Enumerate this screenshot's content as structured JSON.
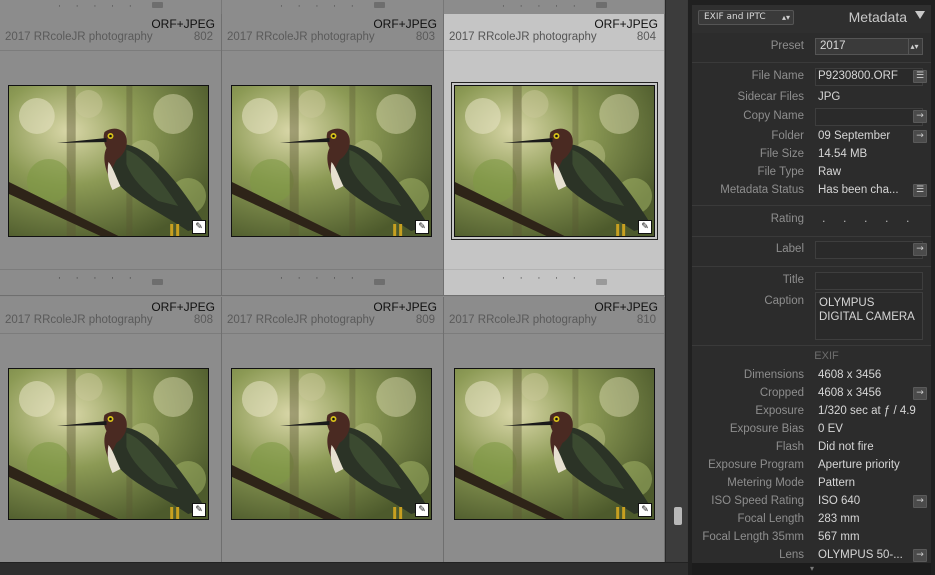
{
  "grid": {
    "cells": [
      {
        "format": "ORF+JPEG",
        "credit": "2017 RRcoleJR photography",
        "number": "802",
        "rating": "· · · · ·",
        "selected": false
      },
      {
        "format": "ORF+JPEG",
        "credit": "2017 RRcoleJR photography",
        "number": "803",
        "rating": "· · · · ·",
        "selected": false
      },
      {
        "format": "ORF+JPEG",
        "credit": "2017 RRcoleJR photography",
        "number": "804",
        "rating": "· · · · ·",
        "selected": true
      },
      {
        "format": "ORF+JPEG",
        "credit": "2017 RRcoleJR photography",
        "number": "808",
        "rating": "",
        "selected": false
      },
      {
        "format": "ORF+JPEG",
        "credit": "2017 RRcoleJR photography",
        "number": "809",
        "rating": "",
        "selected": false
      },
      {
        "format": "ORF+JPEG",
        "credit": "2017 RRcoleJR photography",
        "number": "810",
        "rating": "",
        "selected": false
      }
    ],
    "top_strip_rating": "· · · · ·"
  },
  "panel": {
    "preset_selector": "EXIF and IPTC",
    "title": "Metadata",
    "preset": {
      "label": "Preset",
      "value": "2017"
    },
    "file_name": {
      "label": "File Name",
      "value": "P9230800.ORF"
    },
    "sidecar_files": {
      "label": "Sidecar Files",
      "value": "JPG"
    },
    "copy_name": {
      "label": "Copy Name",
      "value": ""
    },
    "folder": {
      "label": "Folder",
      "value": "09 September"
    },
    "file_size": {
      "label": "File Size",
      "value": "14.54 MB"
    },
    "file_type": {
      "label": "File Type",
      "value": "Raw"
    },
    "metadata_status": {
      "label": "Metadata Status",
      "value": "Has been cha..."
    },
    "rating": {
      "label": "Rating",
      "value": "· · · · ·"
    },
    "label": {
      "label": "Label",
      "value": ""
    },
    "title_field": {
      "label": "Title",
      "value": ""
    },
    "caption": {
      "label": "Caption",
      "value": "OLYMPUS DIGITAL CAMERA"
    },
    "exif_section": "EXIF",
    "exif": [
      {
        "label": "Dimensions",
        "value": "4608 x 3456",
        "button": false
      },
      {
        "label": "Cropped",
        "value": "4608 x 3456",
        "button": true
      },
      {
        "label": "Exposure",
        "value": "1/320 sec at ƒ / 4.9",
        "button": false
      },
      {
        "label": "Exposure Bias",
        "value": "0 EV",
        "button": false
      },
      {
        "label": "Flash",
        "value": "Did not fire",
        "button": false
      },
      {
        "label": "Exposure Program",
        "value": "Aperture priority",
        "button": false
      },
      {
        "label": "Metering Mode",
        "value": "Pattern",
        "button": false
      },
      {
        "label": "ISO Speed Rating",
        "value": "ISO 640",
        "button": true
      },
      {
        "label": "Focal Length",
        "value": "283 mm",
        "button": false
      },
      {
        "label": "Focal Length 35mm",
        "value": "567 mm",
        "button": false
      },
      {
        "label": "Lens",
        "value": "OLYMPUS 50-...",
        "button": true
      }
    ]
  },
  "icons": {
    "go_arrow": "→",
    "list_button": "☰",
    "badge": "✎",
    "stepper": "▴▾"
  },
  "colors": {
    "grid_bg": "#8c8c8c",
    "selected_cell": "#c5c5c5",
    "panel_bg": "#2c2c2c"
  }
}
